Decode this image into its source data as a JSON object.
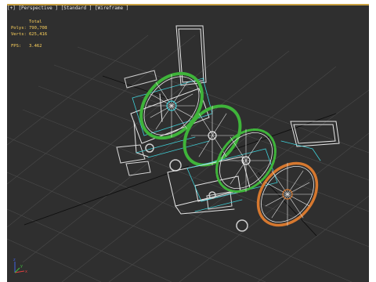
{
  "viewport": {
    "label": "[+] [Perspective ] [Standard ] [Wireframe ]",
    "background": "#2f2f2f",
    "grid_color": "#4a4a4a",
    "grid_main_axis_color": "#000000"
  },
  "stats": {
    "header": "Total",
    "polys_label": "Polys:",
    "polys_value": "790,708",
    "verts_label": "Verts:",
    "verts_value": "625,416",
    "fps_label": "FPS:",
    "fps_value": "3.462",
    "color": "#ffd35c"
  },
  "gizmo": {
    "x_label": "x",
    "y_label": "y",
    "z_label": "z"
  },
  "colors": {
    "frame": "#e8e8e8",
    "helper": "#3fd0d8",
    "wheel_green": "#3fb43a",
    "wheel_orange": "#d6782f",
    "wheel_white": "#f0f0f0"
  }
}
